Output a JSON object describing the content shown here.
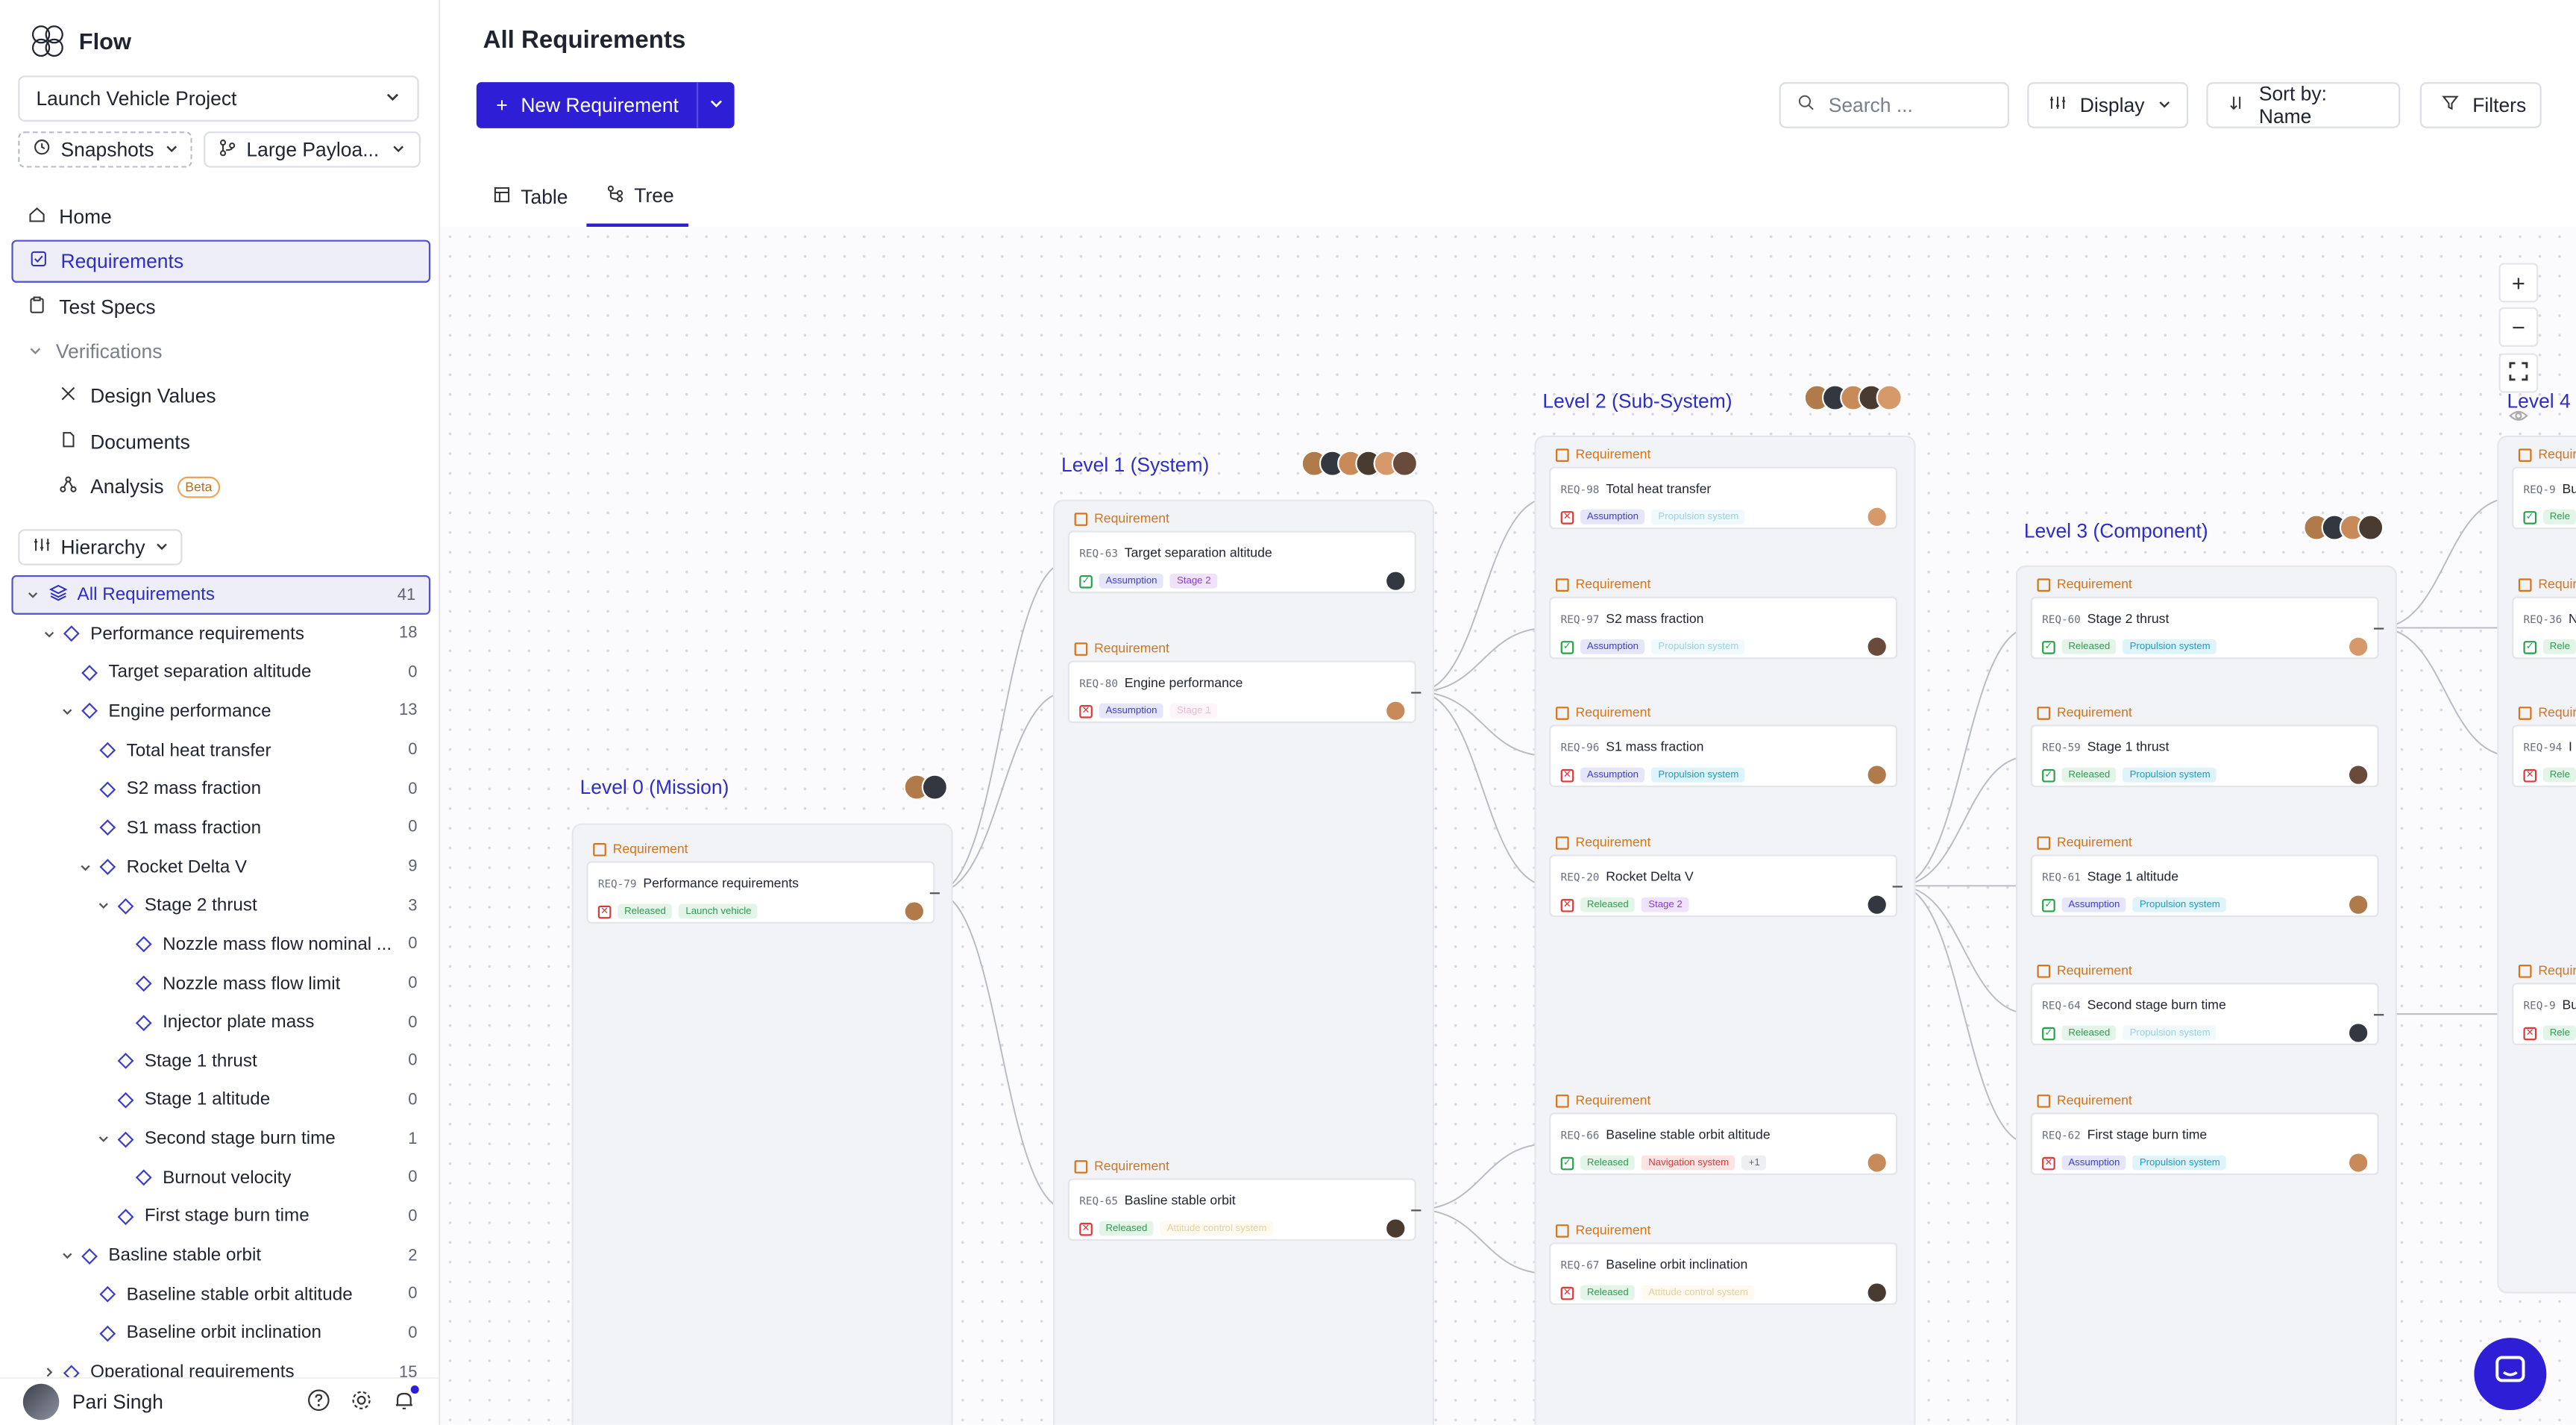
{
  "app": {
    "name": "Flow"
  },
  "project": {
    "name": "Launch Vehicle Project"
  },
  "snapshots": {
    "label": "Snapshots"
  },
  "branch": {
    "label": "Large Payloa..."
  },
  "nav": {
    "home": "Home",
    "requirements": "Requirements",
    "test_specs": "Test Specs",
    "verifications": "Verifications",
    "design_values": "Design Values",
    "documents": "Documents",
    "analysis": "Analysis",
    "beta": "Beta"
  },
  "hierarchy": {
    "label": "Hierarchy"
  },
  "tree": [
    {
      "label": "All Requirements",
      "count": "41",
      "depth": 0,
      "caret": "down",
      "active": true,
      "diamond": false
    },
    {
      "label": "Performance requirements",
      "count": "18",
      "depth": 1,
      "caret": "down"
    },
    {
      "label": "Target separation altitude",
      "count": "0",
      "depth": 2
    },
    {
      "label": "Engine performance",
      "count": "13",
      "depth": 2,
      "caret": "down"
    },
    {
      "label": "Total heat transfer",
      "count": "0",
      "depth": 3
    },
    {
      "label": "S2 mass fraction",
      "count": "0",
      "depth": 3
    },
    {
      "label": "S1 mass fraction",
      "count": "0",
      "depth": 3
    },
    {
      "label": "Rocket Delta V",
      "count": "9",
      "depth": 3,
      "caret": "down"
    },
    {
      "label": "Stage 2 thrust",
      "count": "3",
      "depth": 4,
      "caret": "down"
    },
    {
      "label": "Nozzle mass flow nominal ...",
      "count": "0",
      "depth": 5
    },
    {
      "label": "Nozzle mass flow limit",
      "count": "0",
      "depth": 5
    },
    {
      "label": "Injector plate mass",
      "count": "0",
      "depth": 5
    },
    {
      "label": "Stage 1 thrust",
      "count": "0",
      "depth": 4
    },
    {
      "label": "Stage 1 altitude",
      "count": "0",
      "depth": 4
    },
    {
      "label": "Second stage burn time",
      "count": "1",
      "depth": 4,
      "caret": "down"
    },
    {
      "label": "Burnout velocity",
      "count": "0",
      "depth": 5
    },
    {
      "label": "First stage burn time",
      "count": "0",
      "depth": 4
    },
    {
      "label": "Basline stable orbit",
      "count": "2",
      "depth": 2,
      "caret": "down"
    },
    {
      "label": "Baseline stable orbit altitude",
      "count": "0",
      "depth": 3
    },
    {
      "label": "Baseline orbit inclination",
      "count": "0",
      "depth": 3
    },
    {
      "label": "Operational requirements",
      "count": "15",
      "depth": 1,
      "caret": "right"
    }
  ],
  "user": {
    "name": "Pari Singh"
  },
  "page": {
    "title": "All Requirements"
  },
  "toolbar": {
    "new_requirement": "New Requirement",
    "search_placeholder": "Search ...",
    "display": "Display",
    "sort": "Sort by: Name",
    "filters": "Filters"
  },
  "tabs": {
    "table": "Table",
    "tree": "Tree"
  },
  "canvas": {
    "levels": [
      {
        "title": "Level 0 (Mission)"
      },
      {
        "title": "Level 1 (System)"
      },
      {
        "title": "Level 2 (Sub-System)"
      },
      {
        "title": "Level 3 (Component)"
      },
      {
        "title": "Level 4"
      }
    ],
    "card_type": "Requirement",
    "cards": [
      {
        "id": "REQ-79",
        "name": "Performance requirements",
        "status": "x",
        "tags": [
          "Released",
          "Launch vehicle"
        ]
      },
      {
        "id": "REQ-63",
        "name": "Target separation altitude",
        "status": "ok",
        "tags": [
          "Assumption",
          "Stage 2"
        ]
      },
      {
        "id": "REQ-80",
        "name": "Engine performance",
        "status": "x",
        "tags": [
          "Assumption",
          "Stage 1"
        ]
      },
      {
        "id": "REQ-65",
        "name": "Basline stable orbit",
        "status": "x",
        "tags": [
          "Released",
          "Attitude control system"
        ]
      },
      {
        "id": "REQ-98",
        "name": "Total heat transfer",
        "status": "x",
        "tags": [
          "Assumption",
          "Propulsion system"
        ]
      },
      {
        "id": "REQ-97",
        "name": "S2 mass fraction",
        "status": "ok",
        "tags": [
          "Assumption",
          "Propulsion system"
        ]
      },
      {
        "id": "REQ-96",
        "name": "S1 mass fraction",
        "status": "x",
        "tags": [
          "Assumption",
          "Propulsion system"
        ]
      },
      {
        "id": "REQ-20",
        "name": "Rocket Delta V",
        "status": "x",
        "tags": [
          "Released",
          "Stage 2"
        ]
      },
      {
        "id": "REQ-66",
        "name": "Baseline stable orbit altitude",
        "status": "ok",
        "tags": [
          "Released",
          "Navigation system",
          "+1"
        ]
      },
      {
        "id": "REQ-67",
        "name": "Baseline orbit inclination",
        "status": "x",
        "tags": [
          "Released",
          "Attitude control system"
        ]
      },
      {
        "id": "REQ-60",
        "name": "Stage 2 thrust",
        "status": "ok",
        "tags": [
          "Released",
          "Propulsion system"
        ]
      },
      {
        "id": "REQ-59",
        "name": "Stage 1 thrust",
        "status": "ok",
        "tags": [
          "Released",
          "Propulsion system"
        ]
      },
      {
        "id": "REQ-61",
        "name": "Stage 1 altitude",
        "status": "ok",
        "tags": [
          "Assumption",
          "Propulsion system"
        ]
      },
      {
        "id": "REQ-64",
        "name": "Second stage burn time",
        "status": "ok",
        "tags": [
          "Released",
          "Propulsion system"
        ]
      },
      {
        "id": "REQ-62",
        "name": "First stage burn time",
        "status": "x",
        "tags": [
          "Assumption",
          "Propulsion system"
        ]
      },
      {
        "id": "REQ-9",
        "name": "Bu",
        "status": "ok",
        "tags": [
          "Rele"
        ]
      },
      {
        "id": "REQ-36",
        "name": "N",
        "status": "ok",
        "tags": [
          "Rele"
        ]
      },
      {
        "id": "REQ-94",
        "name": "I",
        "status": "x",
        "tags": [
          "Rele"
        ]
      },
      {
        "id": "REQ-9",
        "name": "Bu",
        "status": "x",
        "tags": [
          "Rele"
        ]
      },
      {
        "id": "REQ-9",
        "name": "",
        "status": "q",
        "tags": [
          "Rele"
        ]
      }
    ],
    "zoom_in": "+",
    "zoom_out": "−"
  },
  "colors": {
    "accent": "#2e1fd6",
    "accent_text": "#2e2ec4",
    "tag_released": "#2e9a52",
    "tag_assumption": "#3d3dc9",
    "tag_stage": "#8a3bd1",
    "tag_propulsion": "#1c9cc2",
    "tag_attitude": "#c79a2a",
    "tag_navigation": "#d93a3a"
  }
}
